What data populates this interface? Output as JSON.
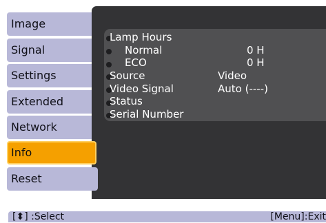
{
  "tabs": [
    {
      "label": "Image",
      "active": false
    },
    {
      "label": "Signal",
      "active": false
    },
    {
      "label": "Settings",
      "active": false
    },
    {
      "label": "Extended",
      "active": false
    },
    {
      "label": "Network",
      "active": false
    },
    {
      "label": "Info",
      "active": true
    },
    {
      "label": "Reset",
      "active": false
    }
  ],
  "info": {
    "lamp_hours_label": "Lamp Hours",
    "normal_label": "Normal",
    "normal_value": "0 H",
    "eco_label": "ECO",
    "eco_value": "0 H",
    "source_label": "Source",
    "source_value": "Video",
    "video_signal_label": "Video Signal",
    "video_signal_value": "Auto (----)",
    "status_label": "Status",
    "serial_label": "Serial Number"
  },
  "footer": {
    "select_hint": "[⬍] :Select",
    "exit_hint": "[Menu]:Exit"
  },
  "colors": {
    "tab": "#b8b8d8",
    "tab_active": "#f5a000",
    "panel": "#333335",
    "info_box": "#505052"
  }
}
